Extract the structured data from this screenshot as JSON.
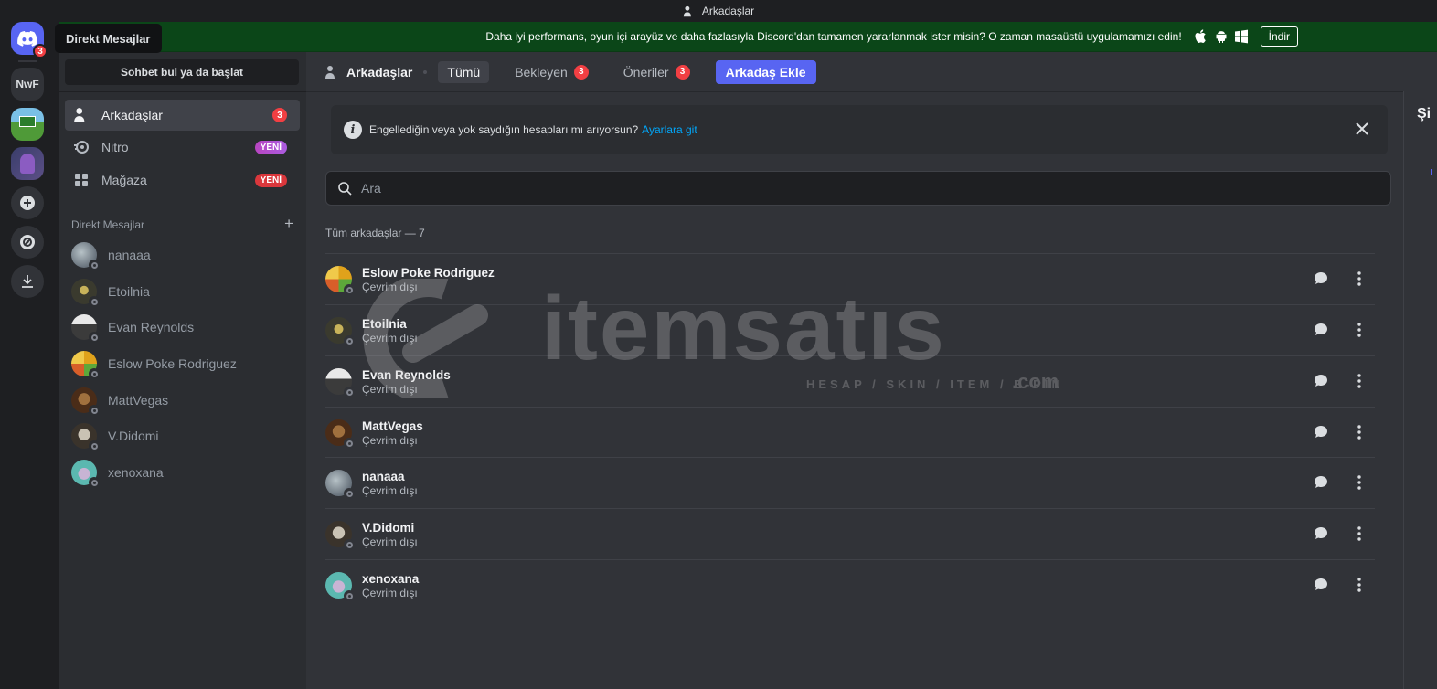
{
  "window": {
    "title": "Arkadaşlar"
  },
  "rail": {
    "home_badge": "3",
    "tooltip": "Direkt Mesajlar",
    "servers": [
      {
        "label": "NwF"
      }
    ]
  },
  "banner": {
    "text": "Daha iyi performans, oyun içi arayüz ve daha fazlasıyla Discord'dan tamamen yararlanmak ister misin? O zaman masaüstü uygulamamızı edin!",
    "download_label": "İndir"
  },
  "sidebar": {
    "search_label": "Sohbet bul ya da başlat",
    "nav": [
      {
        "label": "Arkadaşlar",
        "badge": "3",
        "icon": "friends-icon"
      },
      {
        "label": "Nitro",
        "badge": "YENİ",
        "icon": "nitro-icon"
      },
      {
        "label": "Mağaza",
        "badge": "YENİ",
        "icon": "shop-icon"
      }
    ],
    "dm_header": "Direkt Mesajlar",
    "dm_add": "+",
    "dms": [
      {
        "name": "nanaaa"
      },
      {
        "name": "Etoilnia"
      },
      {
        "name": "Evan Reynolds"
      },
      {
        "name": "Eslow Poke Rodriguez"
      },
      {
        "name": "MattVegas"
      },
      {
        "name": "V.Didomi"
      },
      {
        "name": "xenoxana"
      }
    ]
  },
  "header": {
    "title": "Arkadaşlar",
    "tabs": [
      {
        "label": "Tümü"
      },
      {
        "label": "Bekleyen",
        "badge": "3"
      },
      {
        "label": "Öneriler",
        "badge": "3"
      },
      {
        "label": "Arkadaş Ekle"
      }
    ]
  },
  "notice": {
    "text": "Engellediğin veya yok saydığın hesapları mı arıyorsun?",
    "link": "Ayarlara git"
  },
  "search": {
    "placeholder": "Ara"
  },
  "friends": {
    "count_label": "Tüm arkadaşlar — 7",
    "list": [
      {
        "name": "Eslow Poke Rodriguez",
        "status": "Çevrim dışı"
      },
      {
        "name": "Etoilnia",
        "status": "Çevrim dışı"
      },
      {
        "name": "Evan Reynolds",
        "status": "Çevrim dışı"
      },
      {
        "name": "MattVegas",
        "status": "Çevrim dışı"
      },
      {
        "name": "nanaaa",
        "status": "Çevrim dışı"
      },
      {
        "name": "V.Didomi",
        "status": "Çevrim dışı"
      },
      {
        "name": "xenoxana",
        "status": "Çevrim dışı"
      }
    ]
  },
  "right_panel": {
    "partial_title": "Şi"
  },
  "watermark": {
    "word": "itemsatıs",
    "sub": "HESAP / SKIN / ITEM / E-PIN",
    "domain": ".com"
  },
  "colors": {
    "accent": "#5865f2",
    "danger": "#f23f43",
    "banner": "#0b4618",
    "link": "#00a8fc"
  }
}
